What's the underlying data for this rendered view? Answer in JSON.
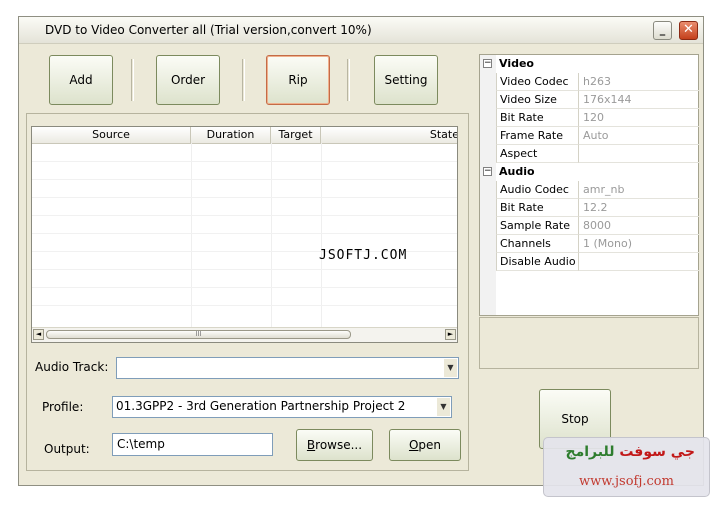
{
  "window": {
    "title": "DVD to Video Converter all (Trial version,convert 10%)",
    "min_label": "_",
    "close_label": "✕"
  },
  "toolbar": {
    "add_label": "Add",
    "order_label": "Order",
    "rip_label": "Rip",
    "setting_label": "Setting"
  },
  "file_list": {
    "columns": [
      "Source",
      "Duration",
      "Target",
      "State"
    ],
    "rows": [],
    "scroll_left": "◄",
    "scroll_right": "►",
    "scroll_grip": "III"
  },
  "watermark_text": "JSOFTJ.COM",
  "audio_track": {
    "label": "Audio Track:",
    "value": ""
  },
  "profile": {
    "label": "Profile:",
    "value": "01.3GPP2 - 3rd Generation Partnership Project 2"
  },
  "output": {
    "label": "Output:",
    "value": "C:\\temp"
  },
  "buttons": {
    "browse_u": "B",
    "browse_rest": "rowse...",
    "open_u": "O",
    "open_rest": "pen",
    "stop_label": "Stop"
  },
  "properties": {
    "video": {
      "category": "Video",
      "items": [
        {
          "name": "Video Codec",
          "value": "h263"
        },
        {
          "name": "Video Size",
          "value": "176x144"
        },
        {
          "name": "Bit Rate",
          "value": "120"
        },
        {
          "name": "Frame Rate",
          "value": "Auto"
        },
        {
          "name": "Aspect",
          "value": ""
        }
      ]
    },
    "audio": {
      "category": "Audio",
      "items": [
        {
          "name": "Audio Codec",
          "value": "amr_nb"
        },
        {
          "name": "Bit Rate",
          "value": "12.2"
        },
        {
          "name": "Sample Rate",
          "value": "8000"
        },
        {
          "name": "Channels",
          "value": "1 (Mono)"
        },
        {
          "name": "Disable Audio",
          "value": ""
        }
      ]
    }
  },
  "logo": {
    "arabic_red": "جي سوفت",
    "arabic_green": "للبرامج",
    "url": "www.jsofj.com"
  }
}
